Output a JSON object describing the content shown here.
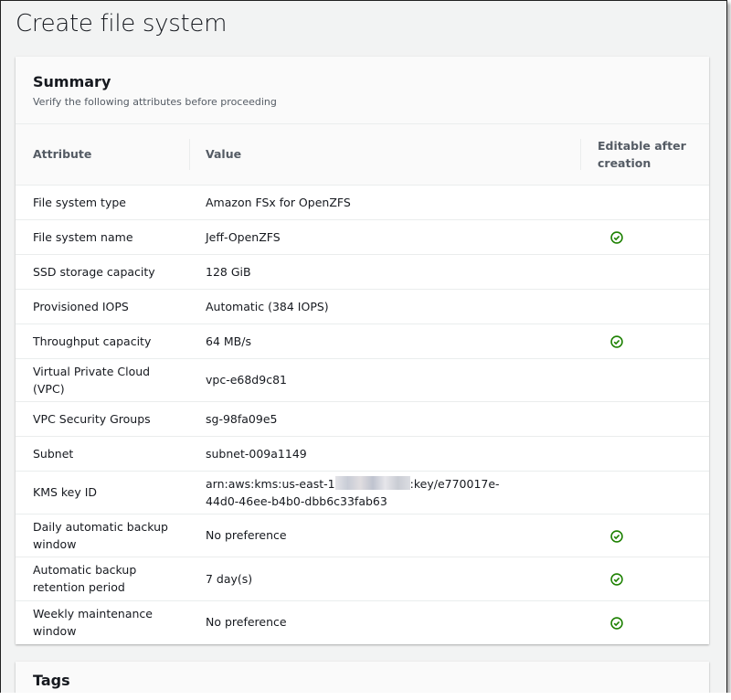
{
  "page": {
    "title": "Create file system"
  },
  "summary": {
    "title": "Summary",
    "subtitle": "Verify the following attributes before proceeding",
    "columns": [
      "Attribute",
      "Value",
      "Editable after creation"
    ],
    "rows": [
      {
        "attribute": "File system type",
        "value": "Amazon FSx for OpenZFS",
        "editable": false
      },
      {
        "attribute": "File system name",
        "value": "Jeff-OpenZFS",
        "editable": true
      },
      {
        "attribute": "SSD storage capacity",
        "value": "128 GiB",
        "editable": false
      },
      {
        "attribute": "Provisioned IOPS",
        "value": "Automatic (384 IOPS)",
        "editable": false
      },
      {
        "attribute": "Throughput capacity",
        "value": "64 MB/s",
        "editable": true
      },
      {
        "attribute": "Virtual Private Cloud (VPC)",
        "value": "vpc-e68d9c81",
        "editable": false
      },
      {
        "attribute": "VPC Security Groups",
        "value": "sg-98fa09e5",
        "editable": false
      },
      {
        "attribute": "Subnet",
        "value": "subnet-009a1149",
        "editable": false
      },
      {
        "attribute": "KMS key ID",
        "value_prefix": "arn:aws:kms:us-east-1",
        "value": ":key/e770017e-44d0-46ee-b4b0-dbb6c33fab63",
        "redacted": true,
        "editable": false
      },
      {
        "attribute": "Daily automatic backup window",
        "value": "No preference",
        "editable": true
      },
      {
        "attribute": "Automatic backup retention period",
        "value": "7 day(s)",
        "editable": true
      },
      {
        "attribute": "Weekly maintenance window",
        "value": "No preference",
        "editable": true
      }
    ]
  },
  "tags": {
    "title": "Tags"
  },
  "colors": {
    "check": "#1d8102"
  }
}
